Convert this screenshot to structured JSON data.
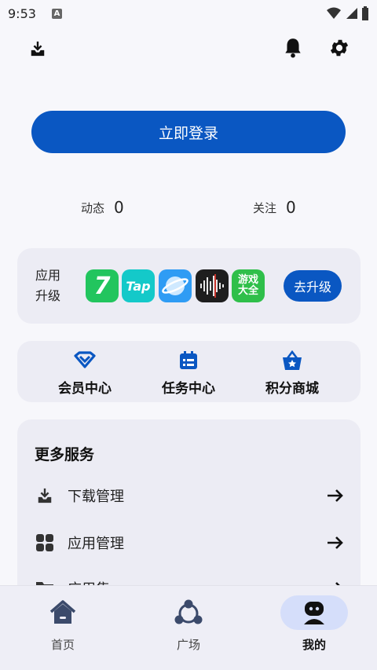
{
  "status_bar": {
    "time": "9:53",
    "notification_icon": "A"
  },
  "header": {
    "download_icon": "download-tray-icon",
    "bell_icon": "bell-icon",
    "settings_icon": "gear-icon"
  },
  "login": {
    "label": "立即登录"
  },
  "stats": [
    {
      "label": "动态",
      "value": "0"
    },
    {
      "label": "关注",
      "value": "0"
    }
  ],
  "upgrade": {
    "label": "应用升级",
    "label_line1": "应用",
    "label_line2": "升级",
    "apps": [
      {
        "name": "7",
        "color": "#22c55e"
      },
      {
        "name": "Tap",
        "color": "#14c9c9"
      },
      {
        "name": "browser",
        "color": "#2f9cf4"
      },
      {
        "name": "recorder",
        "color": "#1e1e1e"
      },
      {
        "name": "游戏大全",
        "color": "#2fbf4a"
      }
    ],
    "button": "去升级"
  },
  "centers": [
    {
      "label": "会员中心",
      "icon": "vip-diamond-icon"
    },
    {
      "label": "任务中心",
      "icon": "task-calendar-icon"
    },
    {
      "label": "积分商城",
      "icon": "shop-basket-icon"
    }
  ],
  "services": {
    "title": "更多服务",
    "items": [
      {
        "label": "下载管理",
        "icon": "download-tray-icon"
      },
      {
        "label": "应用管理",
        "icon": "apps-grid-icon"
      },
      {
        "label": "应用集",
        "icon": "folder-icon"
      }
    ]
  },
  "nav": [
    {
      "label": "首页",
      "icon": "home-icon"
    },
    {
      "label": "广场",
      "icon": "share-network-icon"
    },
    {
      "label": "我的",
      "icon": "profile-icon",
      "active": true
    }
  ],
  "colors": {
    "primary": "#0a57c2",
    "card": "#ececf4",
    "background": "#f7f7fb"
  }
}
